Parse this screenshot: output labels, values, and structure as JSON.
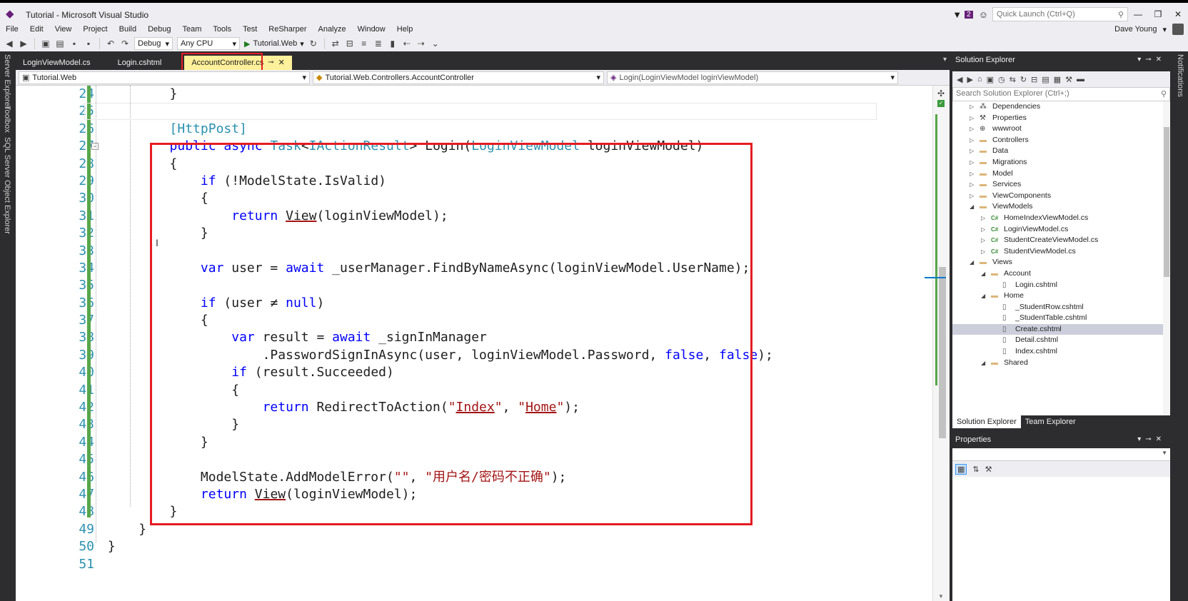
{
  "window": {
    "title": "Tutorial - Microsoft Visual Studio",
    "notification_count": "2",
    "quick_launch_placeholder": "Quick Launch (Ctrl+Q)",
    "user_name": "Dave Young"
  },
  "menu": [
    "File",
    "Edit",
    "View",
    "Project",
    "Build",
    "Debug",
    "Team",
    "Tools",
    "Test",
    "ReSharper",
    "Analyze",
    "Window",
    "Help"
  ],
  "toolbar": {
    "configuration": "Debug",
    "platform": "Any CPU",
    "start_target": "Tutorial.Web"
  },
  "left_strip": [
    "Server Explorer",
    "Toolbox",
    "SQL Server Object Explorer"
  ],
  "right_strip": [
    "Notifications"
  ],
  "doc_tabs": [
    {
      "label": "LoginViewModel.cs",
      "active": false
    },
    {
      "label": "Login.cshtml",
      "active": false
    },
    {
      "label": "AccountController.cs",
      "active": true
    }
  ],
  "nav_bar": {
    "project": "Tutorial.Web",
    "type": "Tutorial.Web.Controllers.AccountController",
    "member": "Login(LoginViewModel loginViewModel)"
  },
  "code": {
    "line_numbers": [
      "24",
      "25",
      "26",
      "27",
      "28",
      "29",
      "30",
      "31",
      "32",
      "33",
      "34",
      "35",
      "36",
      "37",
      "38",
      "39",
      "40",
      "41",
      "42",
      "43",
      "44",
      "45",
      "46",
      "47",
      "48",
      "49",
      "50",
      "51"
    ],
    "line_24": "}",
    "attr": "[HttpPost]",
    "t_public": "public",
    "t_async": "async",
    "t_task": "Task",
    "t_iaction": "IActionResult",
    "t_login": "Login(",
    "t_lvm": "LoginViewModel",
    "t_param": "loginViewModel)",
    "t_lt": "<",
    "t_gt": ">",
    "open_brace": "{",
    "close_brace": "}",
    "t_if": "if",
    "if_cond": "(!ModelState.IsValid)",
    "t_return": "return",
    "t_view": "View",
    "view_args": "(loginViewModel);",
    "t_var": "var",
    "user_decl": "user =",
    "t_await": "await",
    "find_call": "_userManager.FindByNameAsync(loginViewModel.UserName);",
    "if_user_open": "(user ≠",
    "t_null": "null",
    "paren_close": ")",
    "result_decl": "result =",
    "signin": "_signInManager",
    "pwd_call": ".PasswordSignInAsync(user, loginViewModel.Password,",
    "t_false": "false",
    "comma": ",",
    "semi": ");",
    "if_succeeded": "(result.Succeeded)",
    "redirect": "RedirectToAction(",
    "s_index": "Index",
    "s_home": "Home",
    "quote": "\"",
    "add_error": "ModelState.AddModelError(",
    "s_empty": "\"\"",
    "s_msg": "\"用户名/密码不正确\""
  },
  "solution_explorer": {
    "title": "Solution Explorer",
    "search_placeholder": "Search Solution Explorer (Ctrl+;)",
    "items": [
      {
        "label": "Dependencies",
        "depth": 1,
        "expand": "collapsed",
        "icon": "dependencies-icon",
        "selected": false
      },
      {
        "label": "Properties",
        "depth": 1,
        "expand": "collapsed",
        "icon": "wrench-icon",
        "selected": false
      },
      {
        "label": "wwwroot",
        "depth": 1,
        "expand": "collapsed",
        "icon": "globe-icon",
        "selected": false
      },
      {
        "label": "Controllers",
        "depth": 1,
        "expand": "collapsed",
        "icon": "folder-icon",
        "selected": false
      },
      {
        "label": "Data",
        "depth": 1,
        "expand": "collapsed",
        "icon": "folder-icon",
        "selected": false
      },
      {
        "label": "Migrations",
        "depth": 1,
        "expand": "collapsed",
        "icon": "folder-icon",
        "selected": false
      },
      {
        "label": "Model",
        "depth": 1,
        "expand": "collapsed",
        "icon": "folder-icon",
        "selected": false
      },
      {
        "label": "Services",
        "depth": 1,
        "expand": "collapsed",
        "icon": "folder-icon",
        "selected": false
      },
      {
        "label": "ViewComponents",
        "depth": 1,
        "expand": "collapsed",
        "icon": "folder-icon",
        "selected": false
      },
      {
        "label": "ViewModels",
        "depth": 1,
        "expand": "expanded",
        "icon": "folder-icon",
        "selected": false
      },
      {
        "label": "HomeIndexViewModel.cs",
        "depth": 2,
        "expand": "collapsed",
        "icon": "csharp-file-icon",
        "selected": false
      },
      {
        "label": "LoginViewModel.cs",
        "depth": 2,
        "expand": "collapsed",
        "icon": "csharp-file-icon",
        "selected": false
      },
      {
        "label": "StudentCreateViewModel.cs",
        "depth": 2,
        "expand": "collapsed",
        "icon": "csharp-file-icon",
        "selected": false
      },
      {
        "label": "StudentViewModel.cs",
        "depth": 2,
        "expand": "collapsed",
        "icon": "csharp-file-icon",
        "selected": false
      },
      {
        "label": "Views",
        "depth": 1,
        "expand": "expanded",
        "icon": "folder-icon",
        "selected": false
      },
      {
        "label": "Account",
        "depth": 2,
        "expand": "expanded",
        "icon": "folder-icon",
        "selected": false
      },
      {
        "label": "Login.cshtml",
        "depth": 3,
        "expand": "none",
        "icon": "razor-file-icon",
        "selected": false
      },
      {
        "label": "Home",
        "depth": 2,
        "expand": "expanded",
        "icon": "folder-icon",
        "selected": false
      },
      {
        "label": "_StudentRow.cshtml",
        "depth": 3,
        "expand": "none",
        "icon": "razor-file-icon",
        "selected": false
      },
      {
        "label": "_StudentTable.cshtml",
        "depth": 3,
        "expand": "none",
        "icon": "razor-file-icon",
        "selected": false
      },
      {
        "label": "Create.cshtml",
        "depth": 3,
        "expand": "none",
        "icon": "razor-file-icon",
        "selected": true
      },
      {
        "label": "Detail.cshtml",
        "depth": 3,
        "expand": "none",
        "icon": "razor-file-icon",
        "selected": false
      },
      {
        "label": "Index.cshtml",
        "depth": 3,
        "expand": "none",
        "icon": "razor-file-icon",
        "selected": false
      },
      {
        "label": "Shared",
        "depth": 2,
        "expand": "expanded",
        "icon": "folder-icon",
        "selected": false
      }
    ],
    "tabs": [
      {
        "label": "Solution Explorer",
        "active": true
      },
      {
        "label": "Team Explorer",
        "active": false
      }
    ]
  },
  "properties": {
    "title": "Properties"
  },
  "colors": {
    "accent": "#68217a",
    "active_tab": "#fff09b",
    "highlight_box": "#e51c23",
    "keyword": "#0000ff",
    "type": "#2b91af",
    "string": "#a31515"
  }
}
